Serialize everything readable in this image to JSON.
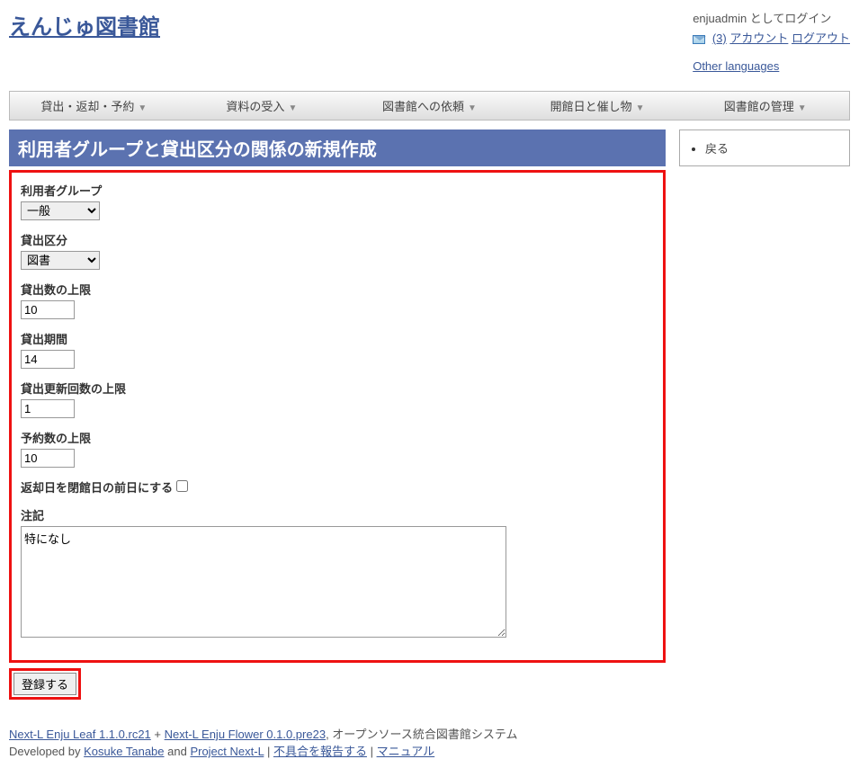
{
  "header": {
    "site_title": "えんじゅ図書館",
    "login_text": "enjuadmin としてログイン",
    "msg_count": "(3)",
    "account_link": "アカウント",
    "logout_link": "ログアウト",
    "other_lang": "Other languages"
  },
  "nav": {
    "items": [
      "貸出・返却・予約",
      "資料の受入",
      "図書館への依頼",
      "開館日と催し物",
      "図書館の管理"
    ]
  },
  "content": {
    "heading": "利用者グループと貸出区分の関係の新規作成",
    "fields": {
      "user_group": {
        "label": "利用者グループ",
        "value": "一般"
      },
      "checkout_type": {
        "label": "貸出区分",
        "value": "図書"
      },
      "checkout_limit": {
        "label": "貸出数の上限",
        "value": "10"
      },
      "checkout_period": {
        "label": "貸出期間",
        "value": "14"
      },
      "renewal_limit": {
        "label": "貸出更新回数の上限",
        "value": "1"
      },
      "reserve_limit": {
        "label": "予約数の上限",
        "value": "10"
      },
      "due_before_closed": {
        "label": "返却日を閉館日の前日にする",
        "checked": false
      },
      "note": {
        "label": "注記",
        "value": "特になし"
      }
    },
    "submit": "登録する"
  },
  "sidebar": {
    "back": "戻る"
  },
  "footer": {
    "leaf_link": "Next-L Enju Leaf 1.1.0.rc21",
    "plus": " + ",
    "flower_link": "Next-L Enju Flower 0.1.0.pre23",
    "tail": ", オープンソース統合図書館システム",
    "dev_prefix": "Developed by ",
    "tanabe": "Kosuke Tanabe",
    "and": " and ",
    "project": "Project Next-L",
    "sep": " | ",
    "report": "不具合を報告する",
    "manual": "マニュアル"
  }
}
